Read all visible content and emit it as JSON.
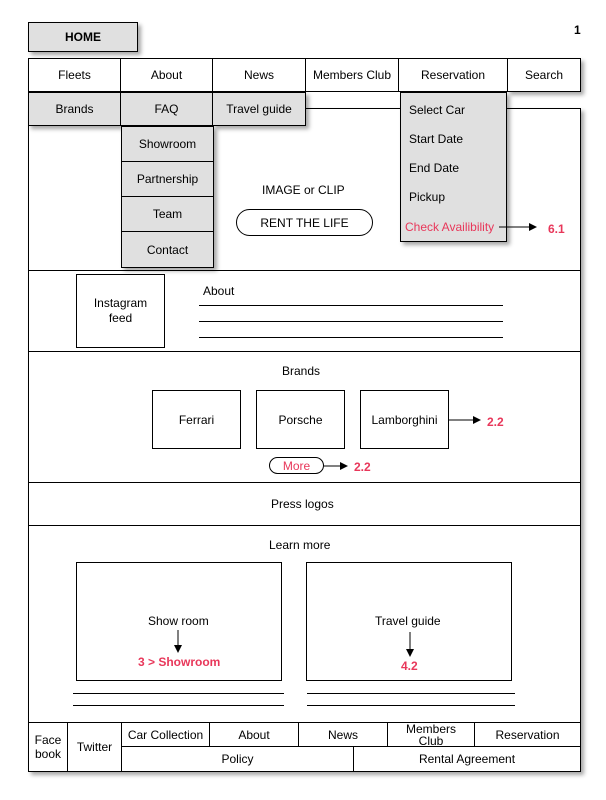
{
  "page_number": "1",
  "home_label": "HOME",
  "nav": {
    "items": [
      "Fleets",
      "About",
      "News",
      "Members Club",
      "Reservation",
      "Search"
    ]
  },
  "subnav": {
    "brands": "Brands",
    "faq": "FAQ",
    "travel_guide": "Travel guide"
  },
  "about_dropdown": [
    "Showroom",
    "Partnership",
    "Team",
    "Contact"
  ],
  "reservation_dropdown": {
    "items": [
      "Select Car",
      "Start Date",
      "End Date",
      "Pickup"
    ],
    "check": "Check Availibility",
    "ref": "6.1"
  },
  "hero": {
    "image_label": "IMAGE or CLIP",
    "cta": "RENT THE LIFE"
  },
  "about_section": {
    "instagram": "Instagram feed",
    "title": "About"
  },
  "brands_section": {
    "title": "Brands",
    "items": [
      "Ferrari",
      "Porsche",
      "Lamborghini"
    ],
    "brand_ref": "2.2",
    "more": "More",
    "more_ref": "2.2"
  },
  "press": "Press logos",
  "learn_more": {
    "title": "Learn more",
    "showroom": "Show room",
    "showroom_ref": "3 > Showroom",
    "travel": "Travel guide",
    "travel_ref": "4.2"
  },
  "footer": {
    "facebook": "Face book",
    "twitter": "Twitter",
    "links": [
      "Car Collection",
      "About",
      "News",
      "Members Club",
      "Reservation"
    ],
    "policy": "Policy",
    "rental": "Rental Agreement"
  },
  "colors": {
    "grey": "#e0e0e0",
    "annotation_red": "#e8375a"
  }
}
